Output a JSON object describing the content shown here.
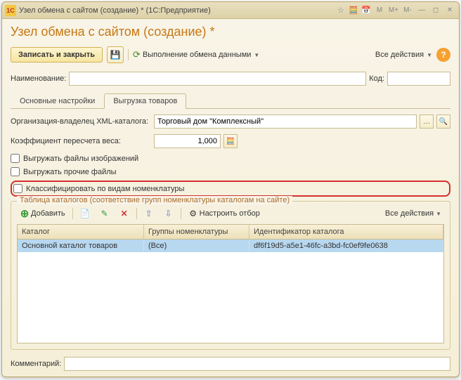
{
  "titlebar": {
    "text": "Узел обмена с сайтом (создание) *  (1С:Предприятие)",
    "m_btns": [
      "M",
      "M+",
      "M-"
    ]
  },
  "page_title": "Узел обмена с сайтом (создание) *",
  "toolbar": {
    "save_close": "Записать и закрыть",
    "exchange": "Выполнение обмена данными",
    "all_actions": "Все действия"
  },
  "fields": {
    "name_label": "Наименование:",
    "name_value": "",
    "code_label": "Код:",
    "code_value": ""
  },
  "tabs": {
    "basic": "Основные настройки",
    "export": "Выгрузка товаров"
  },
  "form": {
    "org_label": "Организация-владелец XML-каталога:",
    "org_value": "Торговый дом \"Комплексный\"",
    "coef_label": "Коэффициент пересчета веса:",
    "coef_value": "1,000",
    "chk_images": "Выгружать файлы изображений",
    "chk_other": "Выгружать прочие файлы",
    "chk_classify": "Классифицировать по видам номенклатуры"
  },
  "groupbox": {
    "title": "Таблица каталогов (соответствие групп номенклатуры каталогам на сайте)",
    "add": "Добавить",
    "filter": "Настроить отбор",
    "all_actions": "Все действия",
    "headers": {
      "catalog": "Каталог",
      "groups": "Группы номенклатуры",
      "id": "Идентификатор каталога"
    },
    "row": {
      "catalog": "Основной каталог товаров",
      "groups": "(Все)",
      "id": "df6f19d5-a5e1-46fc-a3bd-fc0ef9fe0638"
    }
  },
  "comment": {
    "label": "Комментарий:",
    "value": ""
  }
}
